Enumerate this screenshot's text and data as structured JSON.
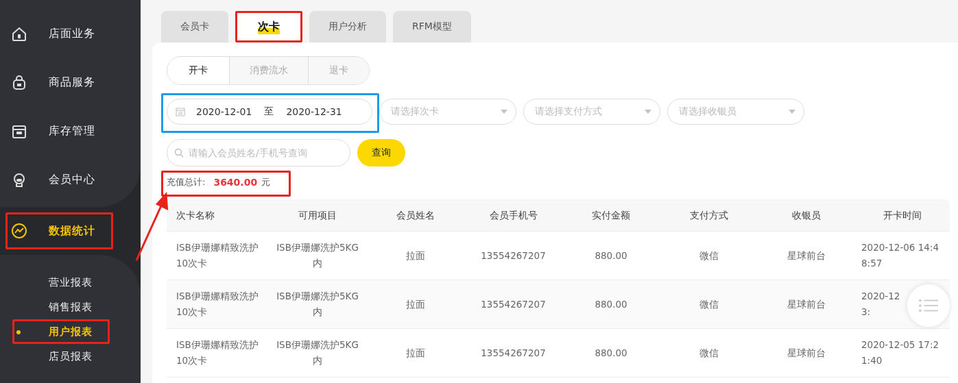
{
  "sidebar": {
    "items": [
      {
        "label": "店面业务",
        "selected": false
      },
      {
        "label": "商品服务",
        "selected": false
      },
      {
        "label": "库存管理",
        "selected": false
      },
      {
        "label": "会员中心",
        "selected": false
      },
      {
        "label": "数据统计",
        "selected": true,
        "highlighted": true,
        "children": [
          {
            "label": "营业报表",
            "selected": false
          },
          {
            "label": "销售报表",
            "selected": false
          },
          {
            "label": "用户报表",
            "selected": true,
            "highlighted": true
          },
          {
            "label": "店员报表",
            "selected": false
          }
        ]
      }
    ]
  },
  "tabs": [
    {
      "label": "会员卡",
      "selected": false
    },
    {
      "label": "次卡",
      "selected": true,
      "highlighted": true
    },
    {
      "label": "用户分析",
      "selected": false
    },
    {
      "label": "RFM模型",
      "selected": false
    }
  ],
  "subtabs": [
    {
      "label": "开卡",
      "selected": true
    },
    {
      "label": "消费流水",
      "selected": false
    },
    {
      "label": "退卡",
      "selected": false
    }
  ],
  "date_range": {
    "start": "2020-12-01",
    "separator": "至",
    "end": "2020-12-31",
    "highlighted": true
  },
  "selects": [
    {
      "placeholder": "请选择次卡"
    },
    {
      "placeholder": "请选择支付方式"
    },
    {
      "placeholder": "请选择收银员"
    }
  ],
  "search": {
    "placeholder": "请输入会员姓名/手机号查询"
  },
  "query_button": "查询",
  "total": {
    "label": "充值总计:",
    "amount": "3640.00",
    "unit": "元",
    "highlighted": true
  },
  "table": {
    "columns": [
      "次卡名称",
      "可用项目",
      "会员姓名",
      "会员手机号",
      "实付金额",
      "支付方式",
      "收银员",
      "开卡时间"
    ],
    "rows": [
      {
        "cells": [
          "ISB伊珊娜精致洗护\n10次卡",
          "ISB伊珊娜洗护5KG\n内",
          "拉面",
          "13554267207",
          "880.00",
          "微信",
          "星球前台",
          "2020-12-06 14:4\n8:57"
        ]
      },
      {
        "cells": [
          "ISB伊珊娜精致洗护\n10次卡",
          "ISB伊珊娜洗护5KG\n内",
          "拉面",
          "13554267207",
          "880.00",
          "微信",
          "星球前台",
          "2020-12\n3:"
        ]
      },
      {
        "cells": [
          "ISB伊珊娜精致洗护\n10次卡",
          "ISB伊珊娜洗护5KG\n内",
          "拉面",
          "13554267207",
          "880.00",
          "微信",
          "星球前台",
          "2020-12-05 17:2\n1:40"
        ]
      }
    ]
  }
}
